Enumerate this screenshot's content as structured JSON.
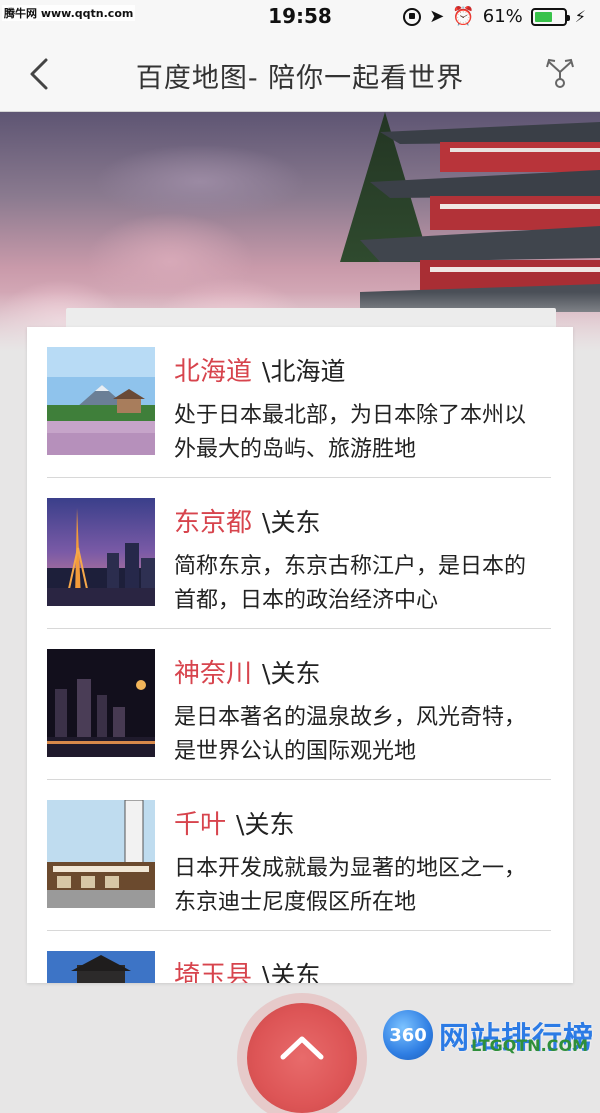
{
  "watermark": {
    "top_left": "腾牛网 www.qqtn.com",
    "bottom_text": "网站排行榜",
    "bottom_badge": "360",
    "bottom_sub": "LTGQTN.COM"
  },
  "status_bar": {
    "time": "19:58",
    "battery_percent_label": "61%",
    "battery_level": 0.61
  },
  "nav": {
    "title": "百度地图- 陪你一起看世界"
  },
  "list": [
    {
      "name": "北海道",
      "region": "\\北海道",
      "desc": "处于日本最北部，为日本除了本州以外最大的岛屿、旅游胜地"
    },
    {
      "name": "东京都",
      "region": "\\关东",
      "desc": "简称东京，东京古称江户，是日本的首都，日本的政治经济中心"
    },
    {
      "name": "神奈川",
      "region": "\\关东",
      "desc": "是日本著名的温泉故乡，风光奇特，是世界公认的国际观光地"
    },
    {
      "name": "千叶",
      "region": "\\关东",
      "desc": "日本开发成就最为显著的地区之一，东京迪士尼度假区所在地"
    },
    {
      "name": "埼玉县",
      "region": "\\关东",
      "desc": ""
    }
  ],
  "colors": {
    "accent": "#d7444d",
    "battery": "#38c24a"
  }
}
